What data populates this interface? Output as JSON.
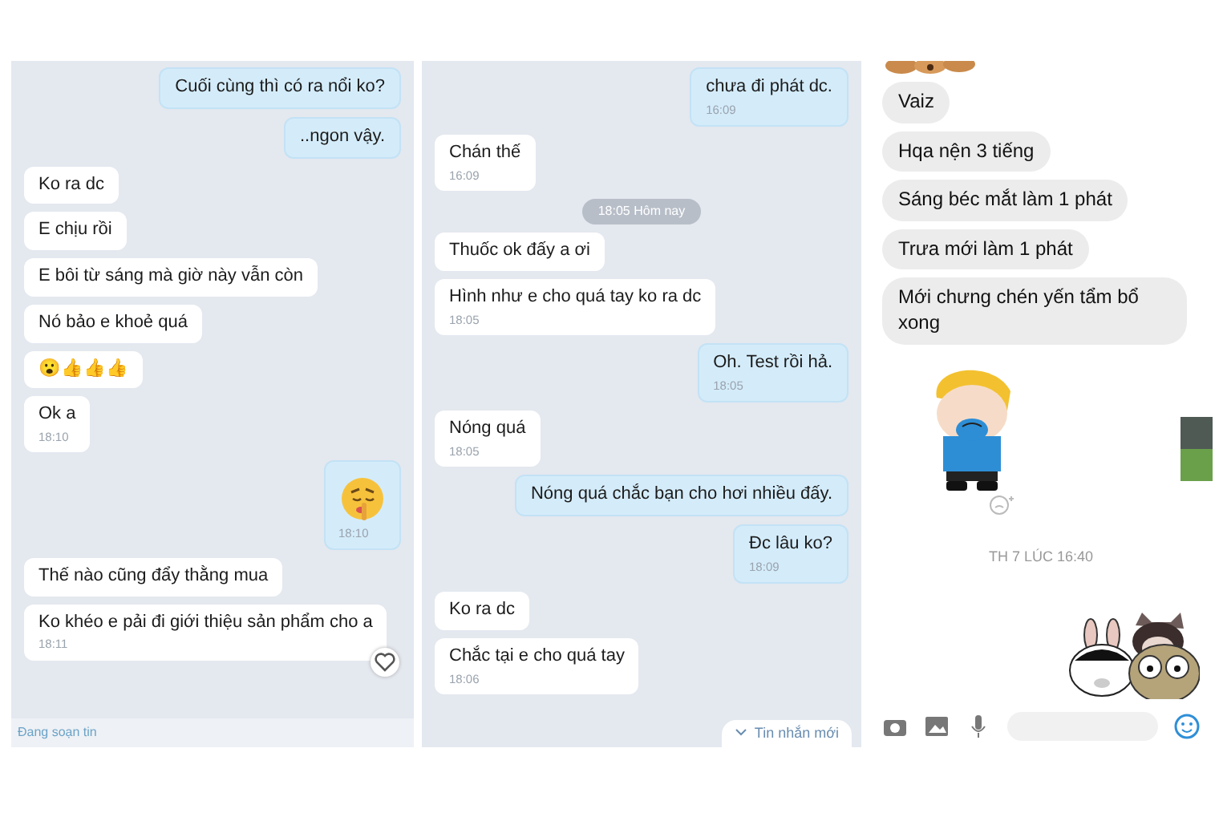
{
  "panels": [
    {
      "kind": "zalo",
      "messages": [
        {
          "kind": "outgoing",
          "text": "Cuối cùng thì có ra nổi ko?",
          "liked": false
        },
        {
          "kind": "outgoing",
          "text": "..ngon vậy.",
          "liked": false
        },
        {
          "kind": "incoming",
          "text": "Ko ra dc",
          "liked": false
        },
        {
          "kind": "incoming",
          "text": "E chịu rồi",
          "liked": false
        },
        {
          "kind": "incoming",
          "text": "E bôi từ sáng mà giờ này vẫn còn",
          "liked": false
        },
        {
          "kind": "incoming",
          "text": "Nó bảo e khoẻ quá",
          "liked": false
        },
        {
          "kind": "incoming",
          "text": "😮👍👍👍",
          "liked": false
        },
        {
          "kind": "incoming",
          "text": "Ok a",
          "time": "18:10",
          "liked": false
        },
        {
          "kind": "sticker_out",
          "time": "18:10"
        },
        {
          "kind": "incoming",
          "text": "Thế nào cũng đẩy thằng mua",
          "liked": false
        },
        {
          "kind": "incoming",
          "text": "Ko khéo e pải đi giới thiệu sản phẩm cho a",
          "time": "18:11",
          "liked": true
        }
      ],
      "footer": "Đang soạn tin"
    },
    {
      "kind": "zalo",
      "messages": [
        {
          "kind": "outgoing",
          "text": "chưa đi phát dc.",
          "time": "16:09"
        },
        {
          "kind": "incoming",
          "text": "Chán thế",
          "time": "16:09"
        },
        {
          "kind": "date",
          "text": "18:05 Hôm nay"
        },
        {
          "kind": "incoming",
          "text": "Thuốc ok đấy a ơi"
        },
        {
          "kind": "incoming",
          "text": "Hình như e cho quá tay ko ra dc",
          "time": "18:05"
        },
        {
          "kind": "outgoing",
          "text": "Oh. Test rồi hả.",
          "time": "18:05"
        },
        {
          "kind": "incoming",
          "text": "Nóng quá",
          "time": "18:05"
        },
        {
          "kind": "outgoing",
          "text": "Nóng quá chắc bạn cho hơi nhiều đấy."
        },
        {
          "kind": "outgoing",
          "text": "Đc lâu ko?",
          "time": "18:09"
        },
        {
          "kind": "incoming",
          "text": "Ko ra dc"
        },
        {
          "kind": "incoming",
          "text": "Chắc tại e cho quá tay",
          "time": "18:06"
        }
      ],
      "footer": "Tin nhắn mới"
    },
    {
      "kind": "messenger",
      "messages": [
        {
          "kind": "sticker_top"
        },
        {
          "kind": "incoming",
          "text": "Vaiz"
        },
        {
          "kind": "incoming",
          "text": "Hqa nện 3 tiếng"
        },
        {
          "kind": "incoming",
          "text": "Sáng béc mắt làm 1 phát"
        },
        {
          "kind": "incoming",
          "text": "Trưa mới làm 1 phát"
        },
        {
          "kind": "incoming",
          "text": "Mới chưng chén yến tẩm bổ xong"
        },
        {
          "kind": "sticker_in"
        },
        {
          "kind": "date",
          "text": "TH 7 LÚC 16:40"
        },
        {
          "kind": "sticker_group"
        }
      ]
    }
  ]
}
